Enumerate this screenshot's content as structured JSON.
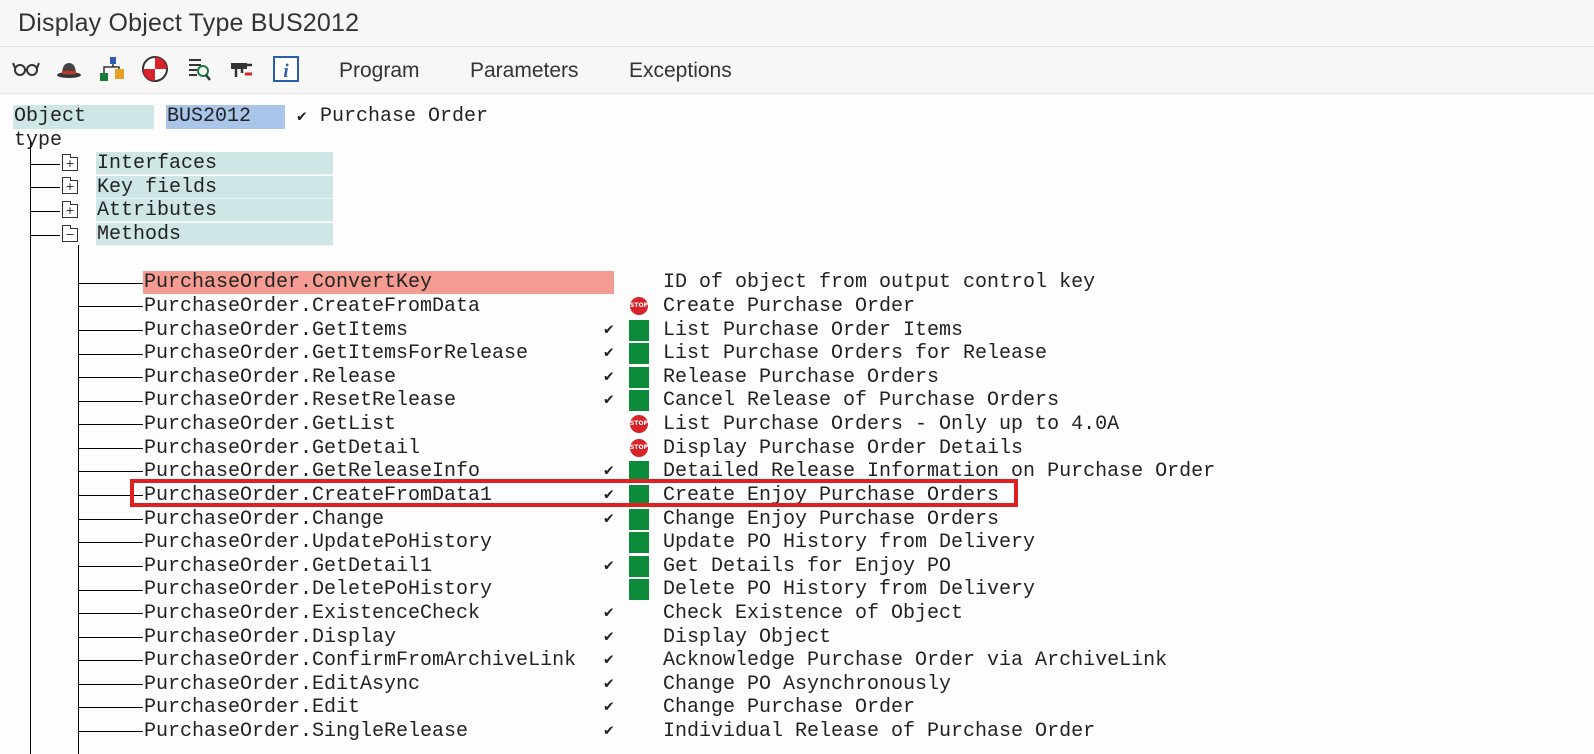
{
  "window": {
    "title": "Display Object Type BUS2012"
  },
  "toolbar": {
    "icons": [
      "glasses-icon",
      "hat-icon",
      "hierarchy-icon",
      "target-icon",
      "list-search-icon",
      "stamp-icon",
      "info-icon"
    ],
    "menu": [
      "Program",
      "Parameters",
      "Exceptions"
    ]
  },
  "object": {
    "label": "Object type",
    "value": "BUS2012",
    "check": "✔",
    "description": "Purchase Order"
  },
  "tree": {
    "nodes": [
      "Interfaces",
      "Key fields",
      "Attributes",
      "Methods"
    ],
    "methods": [
      {
        "name": "PurchaseOrder.ConvertKey",
        "check": "",
        "status": "",
        "desc": "ID of object from output control key"
      },
      {
        "name": "PurchaseOrder.CreateFromData",
        "check": "",
        "status": "stop",
        "desc": "Create Purchase Order"
      },
      {
        "name": "PurchaseOrder.GetItems",
        "check": "✔",
        "status": "green",
        "desc": "List Purchase Order Items"
      },
      {
        "name": "PurchaseOrder.GetItemsForRelease",
        "check": "✔",
        "status": "green",
        "desc": "List Purchase Orders for Release"
      },
      {
        "name": "PurchaseOrder.Release",
        "check": "✔",
        "status": "green",
        "desc": "Release Purchase Orders"
      },
      {
        "name": "PurchaseOrder.ResetRelease",
        "check": "✔",
        "status": "green",
        "desc": "Cancel Release of Purchase Orders"
      },
      {
        "name": "PurchaseOrder.GetList",
        "check": "",
        "status": "stop",
        "desc": "List Purchase Orders - Only up to 4.0A"
      },
      {
        "name": "PurchaseOrder.GetDetail",
        "check": "",
        "status": "stop",
        "desc": "Display Purchase Order Details"
      },
      {
        "name": "PurchaseOrder.GetReleaseInfo",
        "check": "✔",
        "status": "green",
        "desc": "Detailed Release Information on Purchase Order"
      },
      {
        "name": "PurchaseOrder.CreateFromData1",
        "check": "✔",
        "status": "green",
        "desc": "Create Enjoy Purchase Orders"
      },
      {
        "name": "PurchaseOrder.Change",
        "check": "✔",
        "status": "green",
        "desc": "Change Enjoy Purchase Orders"
      },
      {
        "name": "PurchaseOrder.UpdatePoHistory",
        "check": "",
        "status": "green",
        "desc": "Update PO History from Delivery"
      },
      {
        "name": "PurchaseOrder.GetDetail1",
        "check": "✔",
        "status": "green",
        "desc": "Get Details for Enjoy PO"
      },
      {
        "name": "PurchaseOrder.DeletePoHistory",
        "check": "",
        "status": "green",
        "desc": "Delete PO History from Delivery"
      },
      {
        "name": "PurchaseOrder.ExistenceCheck",
        "check": "✔",
        "status": "",
        "desc": "Check Existence of Object"
      },
      {
        "name": "PurchaseOrder.Display",
        "check": "✔",
        "status": "",
        "desc": "Display Object"
      },
      {
        "name": "PurchaseOrder.ConfirmFromArchiveLink",
        "check": "✔",
        "status": "",
        "desc": "Acknowledge Purchase Order via ArchiveLink"
      },
      {
        "name": "PurchaseOrder.EditAsync",
        "check": "✔",
        "status": "",
        "desc": "Change PO Asynchronously"
      },
      {
        "name": "PurchaseOrder.Edit",
        "check": "✔",
        "status": "",
        "desc": "Change Purchase Order"
      },
      {
        "name": "PurchaseOrder.SingleRelease",
        "check": "✔",
        "status": "",
        "desc": "Individual Release of Purchase Order"
      }
    ]
  },
  "status_labels": {
    "stop": "STOP"
  },
  "colors": {
    "selected_row": "#f59c92",
    "status_green": "#0c8c3a",
    "status_stop": "#d8232a",
    "highlight_box": "#e02020",
    "node_label_bg": "#cfe6e6"
  }
}
